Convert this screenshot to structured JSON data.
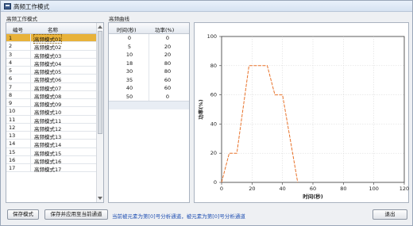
{
  "window": {
    "title": "高频工作模式"
  },
  "left_section": {
    "label": "高频工作模式",
    "columns": [
      "编号",
      "名称"
    ],
    "rows": [
      {
        "num": "1",
        "name": "高频模式01",
        "selected": true
      },
      {
        "num": "2",
        "name": "高频模式02"
      },
      {
        "num": "3",
        "name": "高频模式03"
      },
      {
        "num": "4",
        "name": "高频模式04"
      },
      {
        "num": "5",
        "name": "高频模式05"
      },
      {
        "num": "6",
        "name": "高频模式06"
      },
      {
        "num": "7",
        "name": "高频模式07"
      },
      {
        "num": "8",
        "name": "高频模式08"
      },
      {
        "num": "9",
        "name": "高频模式09"
      },
      {
        "num": "10",
        "name": "高频模式10"
      },
      {
        "num": "11",
        "name": "高频模式11"
      },
      {
        "num": "12",
        "name": "高频模式12"
      },
      {
        "num": "13",
        "name": "高频模式13"
      },
      {
        "num": "14",
        "name": "高频模式14"
      },
      {
        "num": "15",
        "name": "高频模式15"
      },
      {
        "num": "16",
        "name": "高频模式16"
      },
      {
        "num": "17",
        "name": "高频模式17"
      }
    ]
  },
  "curve_section": {
    "label": "高频曲线",
    "columns": [
      "时间(秒)",
      "功率(%)"
    ],
    "rows": [
      {
        "t": "0",
        "p": "0"
      },
      {
        "t": "5",
        "p": "20"
      },
      {
        "t": "10",
        "p": "20"
      },
      {
        "t": "18",
        "p": "80"
      },
      {
        "t": "30",
        "p": "80"
      },
      {
        "t": "35",
        "p": "60"
      },
      {
        "t": "40",
        "p": "60"
      },
      {
        "t": "50",
        "p": "0"
      }
    ]
  },
  "chart_data": {
    "type": "line",
    "x": [
      0,
      5,
      10,
      18,
      30,
      35,
      40,
      50
    ],
    "y": [
      0,
      20,
      20,
      80,
      80,
      60,
      60,
      0
    ],
    "xlabel": "时间(秒)",
    "ylabel": "功率(%)",
    "xlim": [
      0,
      120
    ],
    "ylim": [
      0,
      100
    ],
    "xticks": [
      0,
      20,
      40,
      60,
      80,
      100,
      120
    ],
    "yticks": [
      0,
      20,
      40,
      60,
      80,
      100
    ],
    "grid": true,
    "line_color": "#e8722a",
    "line_style": "dashed"
  },
  "buttons": {
    "save_mode": "保存模式",
    "save_apply": "保存并应用至当前通道",
    "exit": "退出"
  },
  "status": "当前被元素为第[0]号分析通道，被元素为第[0]号分析通道"
}
